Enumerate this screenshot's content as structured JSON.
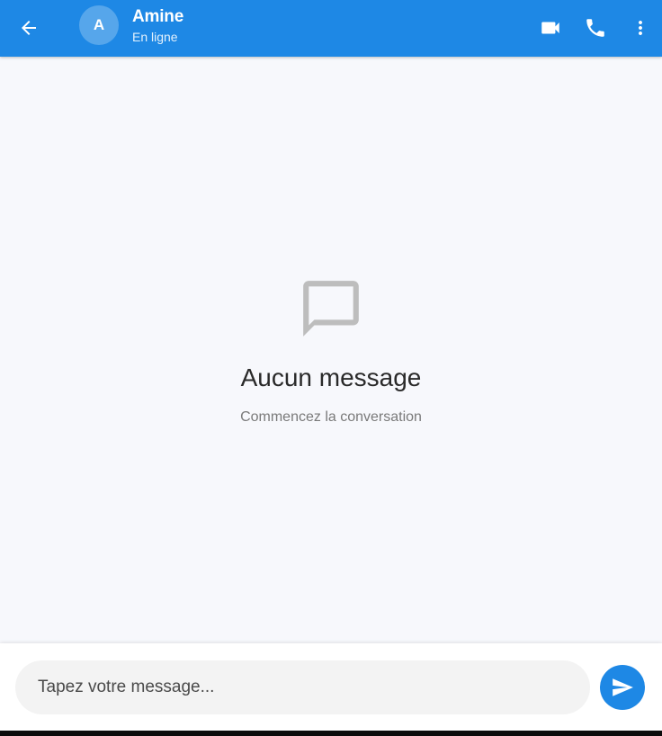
{
  "header": {
    "avatar_initial": "A",
    "contact_name": "Amine",
    "status": "En ligne",
    "background_color": "#1e88e5",
    "icons": [
      "back-arrow-icon",
      "video-camera-icon",
      "phone-icon",
      "more-vertical-icon"
    ]
  },
  "empty_state": {
    "icon": "chat-bubble-icon",
    "title": "Aucun message",
    "subtitle": "Commencez la conversation"
  },
  "composer": {
    "placeholder": "Tapez votre message...",
    "value": "",
    "send_icon": "send-icon",
    "accent_color": "#1e88e5"
  }
}
